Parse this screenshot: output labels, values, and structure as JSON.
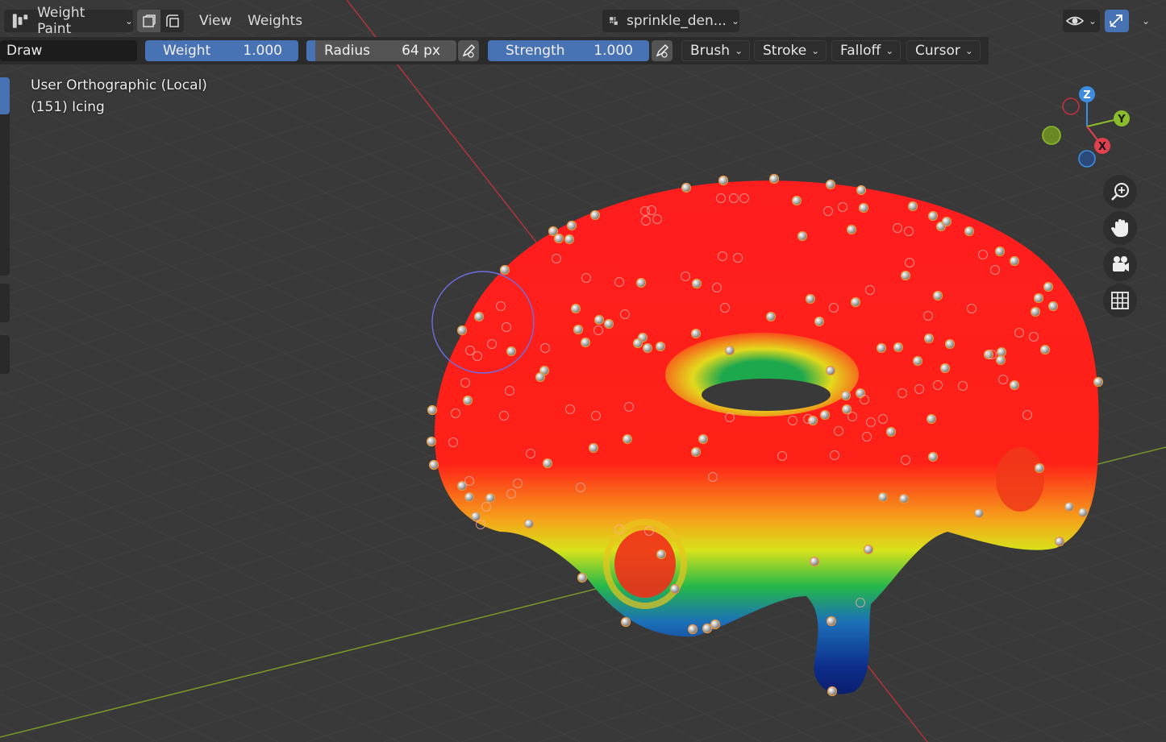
{
  "header": {
    "mode_label": "Weight Paint",
    "mode_icon": "weight-paint-icon",
    "menus": [
      "View",
      "Weights"
    ],
    "object_name": "sprinkle_den..."
  },
  "tool_settings": {
    "brush_name": "Draw",
    "weight": {
      "label": "Weight",
      "value": "1.000",
      "fill": 1.0
    },
    "radius": {
      "label": "Radius",
      "value": "64 px",
      "fill": 0.06
    },
    "strength": {
      "label": "Strength",
      "value": "1.000",
      "fill": 1.0
    },
    "dropdowns": [
      "Brush",
      "Stroke",
      "Falloff",
      "Cursor"
    ]
  },
  "viewport": {
    "view_name": "User Orthographic (Local)",
    "object_info": "(151) Icing"
  },
  "gizmo": {
    "z": "Z",
    "y": "Y",
    "x": "X"
  },
  "nav_icons": [
    "zoom-icon",
    "hand-pan-icon",
    "camera-icon",
    "grid-icon"
  ],
  "colors": {
    "background": "#393939",
    "accent": "#4772b3",
    "axis_x": "#e2404f",
    "axis_y": "#8bbc2c",
    "axis_z": "#3d8ce0"
  }
}
